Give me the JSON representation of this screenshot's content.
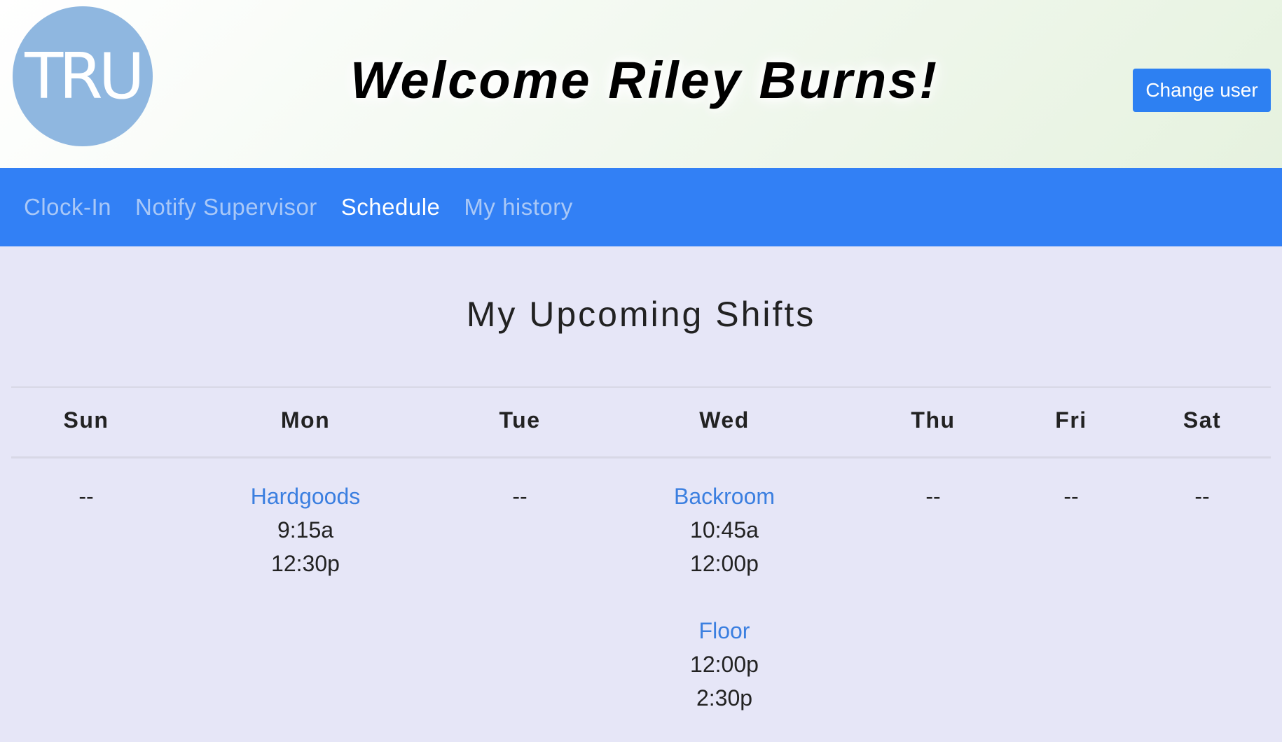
{
  "header": {
    "logo_text": "TRU",
    "welcome": "Welcome Riley Burns!",
    "change_user_label": "Change user",
    "colors": {
      "logo": "#8fb7e0",
      "button": "#2d80f2"
    }
  },
  "nav": {
    "items": [
      {
        "label": "Clock-In",
        "active": false
      },
      {
        "label": "Notify Supervisor",
        "active": false
      },
      {
        "label": "Schedule",
        "active": true
      },
      {
        "label": "My history",
        "active": false
      }
    ],
    "background": "#3280f5"
  },
  "main": {
    "title": "My Upcoming Shifts",
    "days": [
      {
        "name": "Sun",
        "empty": "--",
        "shifts": []
      },
      {
        "name": "Mon",
        "empty": "",
        "shifts": [
          {
            "dept": "Hardgoods",
            "start": "9:15a",
            "end": "12:30p"
          }
        ]
      },
      {
        "name": "Tue",
        "empty": "--",
        "shifts": []
      },
      {
        "name": "Wed",
        "empty": "",
        "shifts": [
          {
            "dept": "Backroom",
            "start": "10:45a",
            "end": "12:00p"
          },
          {
            "dept": "Floor",
            "start": "12:00p",
            "end": "2:30p"
          }
        ]
      },
      {
        "name": "Thu",
        "empty": "--",
        "shifts": []
      },
      {
        "name": "Fri",
        "empty": "--",
        "shifts": []
      },
      {
        "name": "Sat",
        "empty": "--",
        "shifts": []
      }
    ]
  }
}
